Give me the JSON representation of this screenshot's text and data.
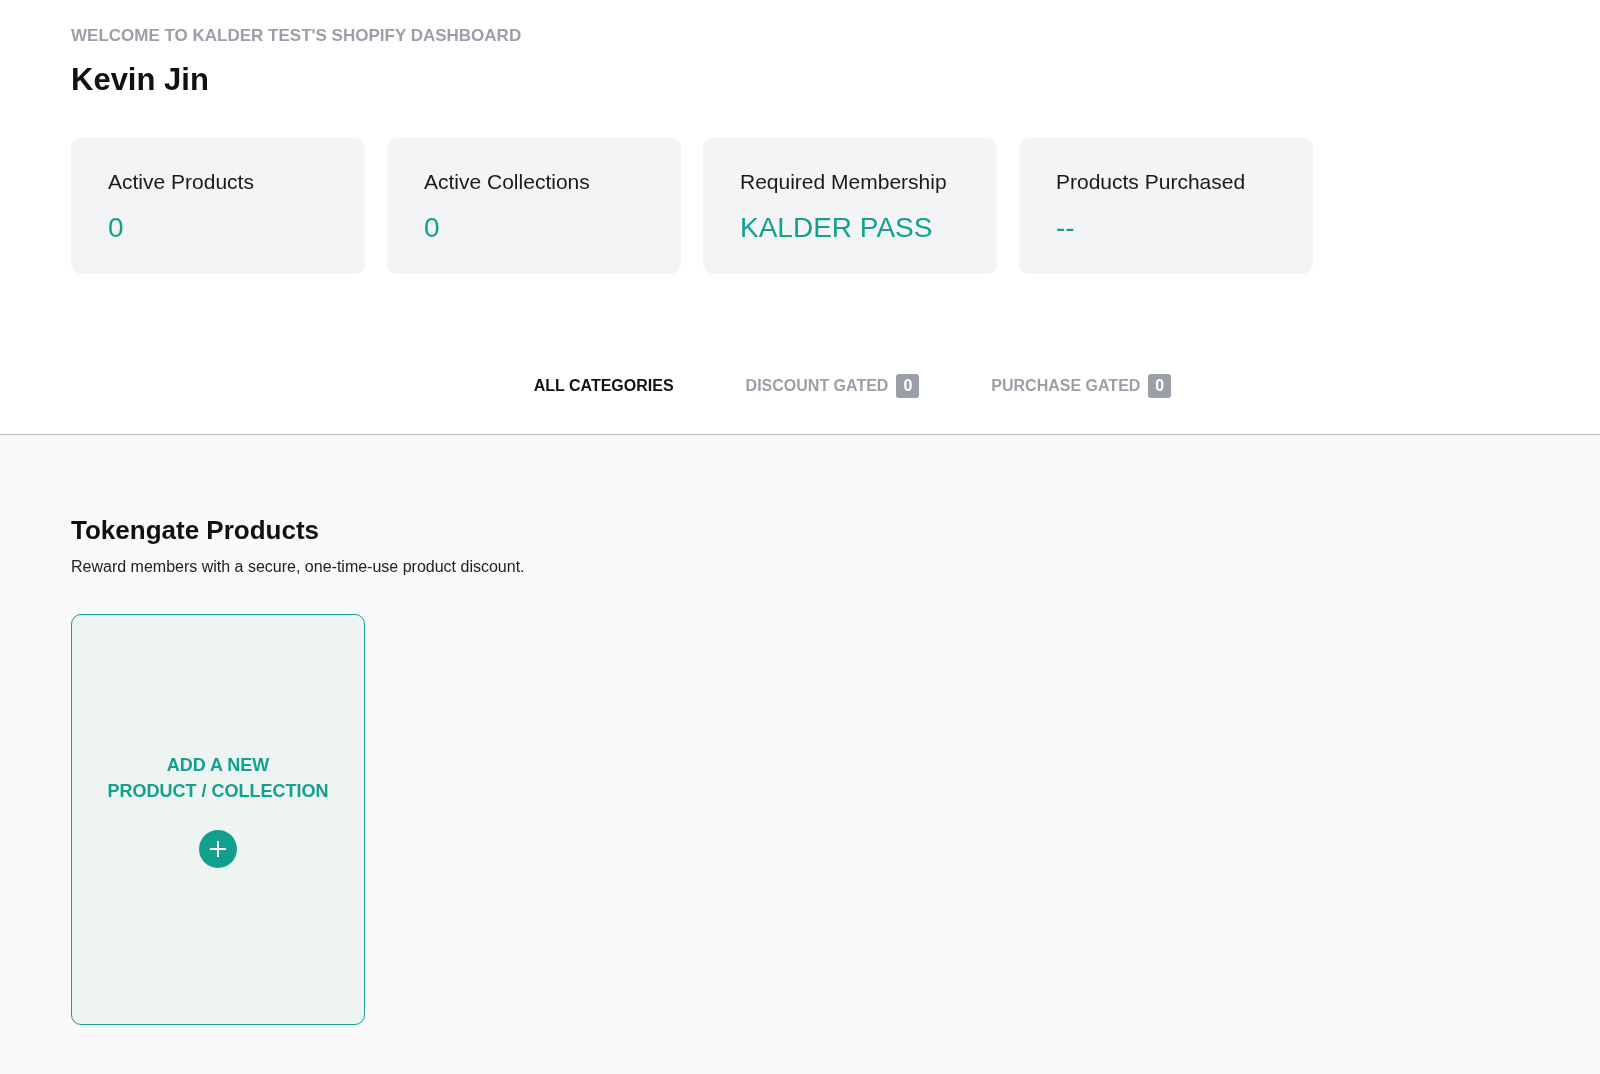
{
  "header": {
    "welcome": "WELCOME TO KALDER TEST'S SHOPIFY DASHBOARD",
    "name": "Kevin Jin"
  },
  "stats": [
    {
      "label": "Active Products",
      "value": "0"
    },
    {
      "label": "Active Collections",
      "value": "0"
    },
    {
      "label": "Required Membership",
      "value": "KALDER PASS"
    },
    {
      "label": "Products Purchased",
      "value": "--"
    }
  ],
  "tabs": [
    {
      "label": "ALL CATEGORIES",
      "selected": true
    },
    {
      "label": "DISCOUNT GATED",
      "count": "0",
      "selected": false
    },
    {
      "label": "PURCHASE GATED",
      "count": "0",
      "selected": false
    }
  ],
  "section": {
    "title": "Tokengate Products",
    "subtitle": "Reward members with a secure, one-time-use product discount.",
    "add_card": {
      "line_1": "ADD A NEW",
      "line_2": "PRODUCT / COLLECTION"
    }
  }
}
